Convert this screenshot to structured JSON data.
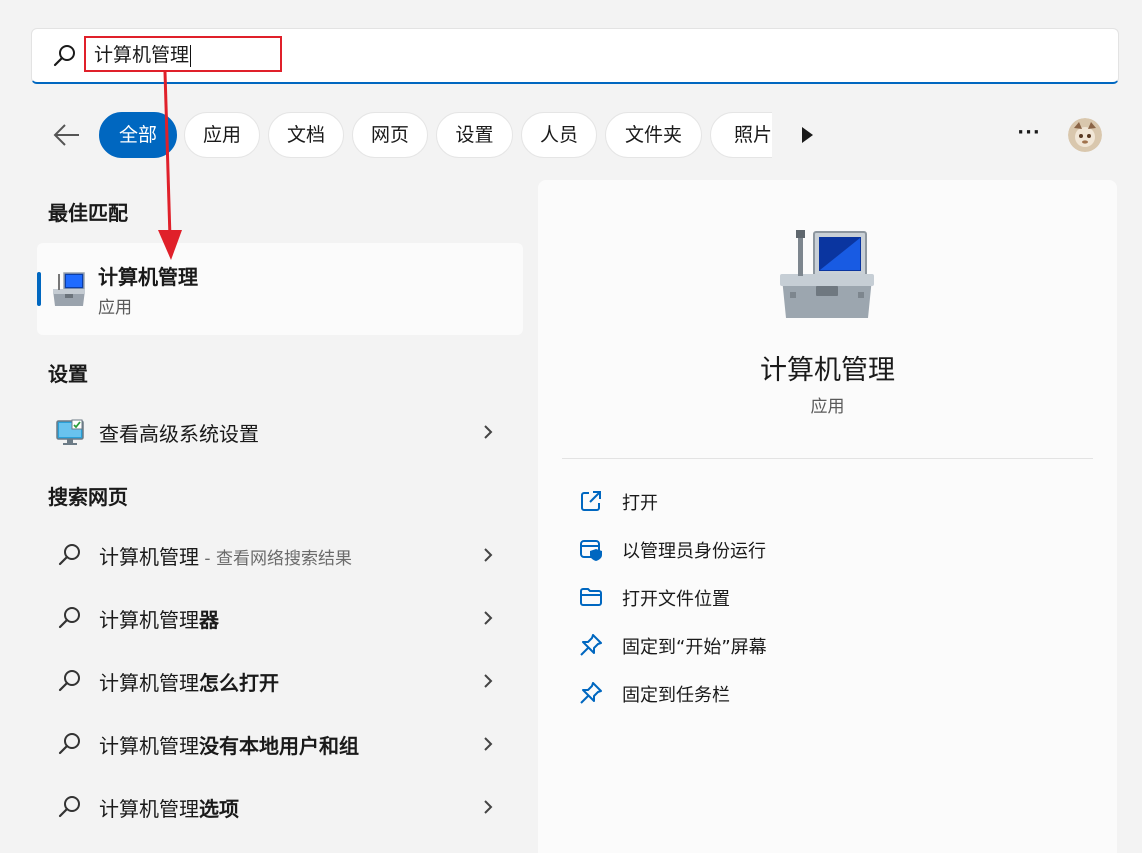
{
  "search": {
    "query": "计算机管理"
  },
  "filters": {
    "tabs": [
      {
        "label": "全部",
        "active": true
      },
      {
        "label": "应用",
        "active": false
      },
      {
        "label": "文档",
        "active": false
      },
      {
        "label": "网页",
        "active": false
      },
      {
        "label": "设置",
        "active": false
      },
      {
        "label": "人员",
        "active": false
      },
      {
        "label": "文件夹",
        "active": false
      },
      {
        "label": "照片",
        "active": false
      }
    ],
    "more_label": "···"
  },
  "best_match": {
    "heading": "最佳匹配",
    "title": "计算机管理",
    "subtitle": "应用"
  },
  "settings": {
    "heading": "设置",
    "items": [
      {
        "label": "查看高级系统设置"
      }
    ]
  },
  "web": {
    "heading": "搜索网页",
    "items": [
      {
        "prefix": "计算机管理",
        "suffix": "",
        "hint": " - 查看网络搜索结果"
      },
      {
        "prefix": "计算机管理",
        "suffix": "器",
        "hint": ""
      },
      {
        "prefix": "计算机管理",
        "suffix": "怎么打开",
        "hint": ""
      },
      {
        "prefix": "计算机管理",
        "suffix": "没有本地用户和组",
        "hint": ""
      },
      {
        "prefix": "计算机管理",
        "suffix": "选项",
        "hint": ""
      }
    ]
  },
  "detail": {
    "title": "计算机管理",
    "subtitle": "应用",
    "actions": [
      {
        "label": "打开",
        "icon": "open-external-icon"
      },
      {
        "label": "以管理员身份运行",
        "icon": "shield-icon"
      },
      {
        "label": "打开文件位置",
        "icon": "folder-icon"
      },
      {
        "label": "固定到“开始”屏幕",
        "icon": "pin-icon"
      },
      {
        "label": "固定到任务栏",
        "icon": "pin-icon"
      }
    ]
  },
  "colors": {
    "accent": "#0067c0",
    "annotation": "#e0202a"
  }
}
